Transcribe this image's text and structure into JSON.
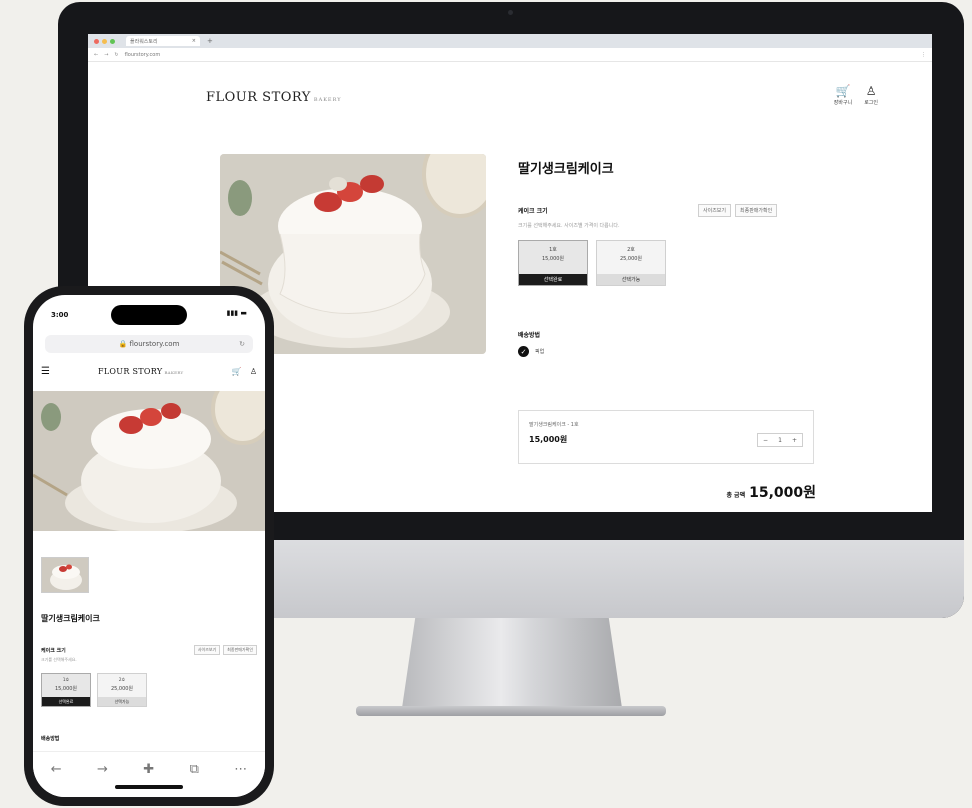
{
  "desktop": {
    "browser": {
      "tab_title": "플라워스토리",
      "tab_close": "×",
      "tab_add": "+",
      "nav_back": "←",
      "nav_forward": "→",
      "nav_reload": "↻",
      "url": "flourstory.com",
      "menu_glyph": "⋮"
    },
    "header": {
      "logo": "FLOUR STORY",
      "logo_sub": "BAKERY",
      "cart_icon": "🛒",
      "cart_label": "장바구니",
      "login_icon": "♙",
      "login_label": "로그인"
    },
    "product": {
      "title": "딸기생크림케이크",
      "option_label": "케이크 크기",
      "option_help": "크기를 선택해주세요. 사이즈별 가격이 다릅니다.",
      "link_1": "사이즈보기",
      "link_2": "최종판매가확인",
      "sizes": [
        {
          "name": "1호",
          "price": "15,000원",
          "button": "선택완료"
        },
        {
          "name": "2호",
          "price": "25,000원",
          "button": "선택가능"
        }
      ],
      "shipping_label": "배송방법",
      "shipping_option": "픽업",
      "check_glyph": "✓",
      "selected_name": "딸기생크림케이크 - 1호",
      "selected_price": "15,000원",
      "qty_minus": "−",
      "qty_value": "1",
      "qty_plus": "+",
      "total_label": "총 금액",
      "total_value": "15,000원"
    }
  },
  "mobile": {
    "time": "3:00",
    "status": "▮▮▮ ▬",
    "url": "🔒 flourstory.com",
    "reload": "↻",
    "menu_icon": "☰",
    "logo": "FLOUR STORY",
    "logo_sub": "BAKERY",
    "cart_icon": "🛒",
    "user_icon": "♙",
    "title": "딸기생크림케이크",
    "option_label": "케이크 크기",
    "option_help": "크기를 선택해주세요.",
    "link_1": "사이즈보기",
    "link_2": "최종판매가확인",
    "sizes": [
      {
        "name": "1호",
        "price": "15,000원",
        "button": "선택완료"
      },
      {
        "name": "2호",
        "price": "25,000원",
        "button": "선택가능"
      }
    ],
    "shipping_label": "배송방법",
    "toolbar": {
      "back": "←",
      "forward": "→",
      "add": "✚",
      "tabs": "⧉",
      "more": "⋯"
    }
  }
}
